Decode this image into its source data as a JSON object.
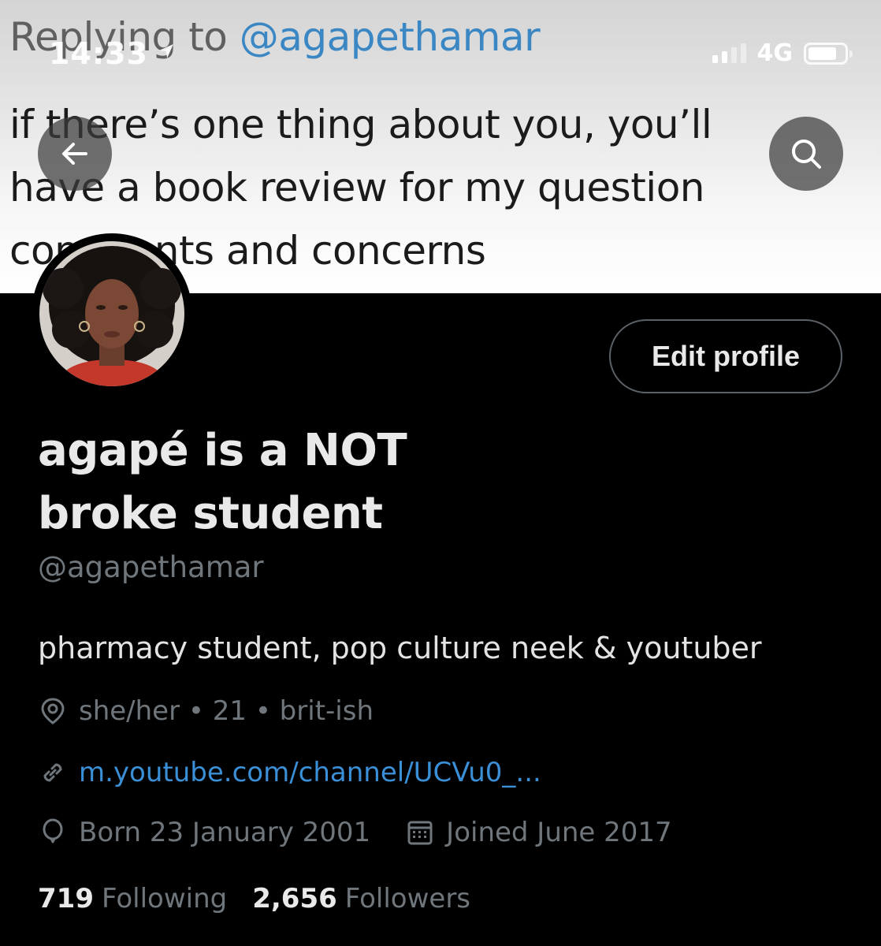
{
  "banner": {
    "reply_prefix": "Replying to ",
    "reply_handle": "@agapethamar",
    "tweet_line_1": "if there’s one thing about you, you’ll",
    "tweet_line_2": "have a book review for my question",
    "tweet_line_3": "comments and concerns"
  },
  "status_bar": {
    "time": "14:33",
    "network": "4G",
    "signal_bars_active": 2,
    "signal_bars_total": 4,
    "battery_level": 0.8,
    "location_icon": "location-arrow-icon"
  },
  "header": {
    "back_icon": "arrow-left-icon",
    "search_icon": "search-icon"
  },
  "profile": {
    "edit_label": "Edit profile",
    "name_line_1": "agapé is a NOT",
    "name_line_2": "broke student",
    "handle": "@agapethamar",
    "bio": "pharmacy student, pop culture neek & youtuber",
    "location": "she/her • 21 • brit-ish",
    "link": "m.youtube.com/channel/UCVu0_...",
    "born": "Born 23 January 2001",
    "joined": "Joined June 2017",
    "following_count": "719",
    "following_label": "Following",
    "followers_count": "2,656",
    "followers_label": "Followers"
  },
  "colors": {
    "background": "#000000",
    "primary_text": "#e9e9e9",
    "secondary_text": "#6f767c",
    "link": "#3a8fd6",
    "reply_handle": "#3b87c3"
  }
}
